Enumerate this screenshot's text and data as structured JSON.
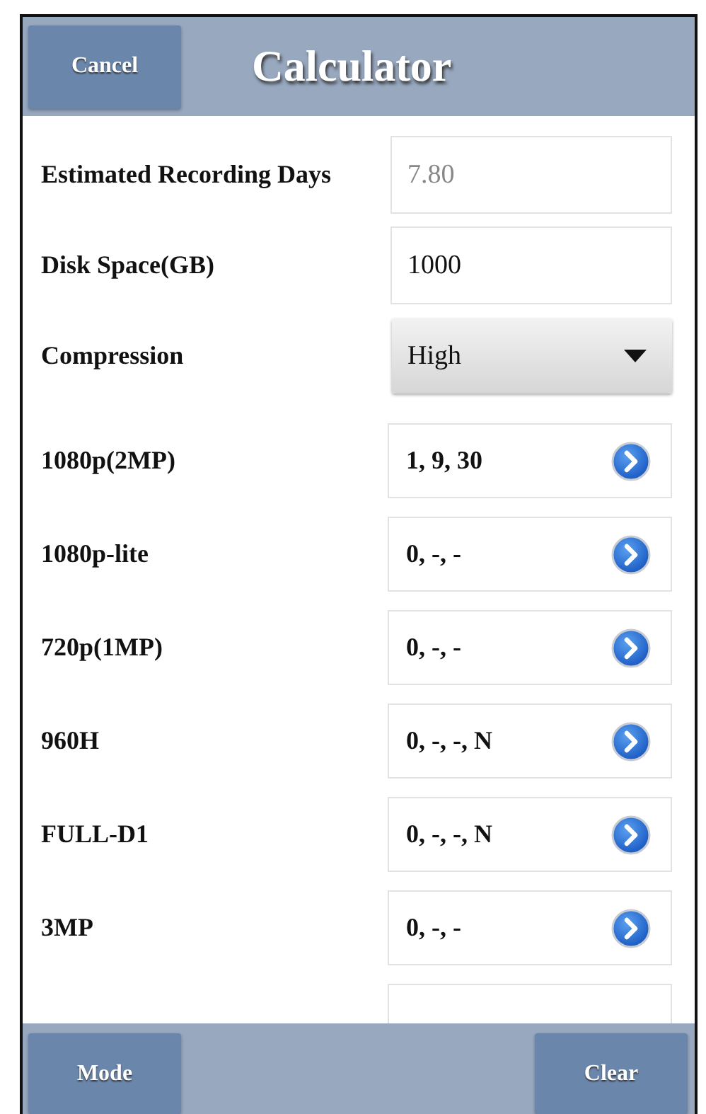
{
  "header": {
    "cancel_button": "Cancel",
    "title": "Calculator"
  },
  "settings": [
    {
      "kind": "readonly",
      "label": "Estimated Recording Days",
      "value": "7.80"
    },
    {
      "kind": "input",
      "label": "Disk Space(GB)",
      "value": "1000"
    },
    {
      "kind": "select",
      "label": "Compression",
      "value": "High"
    }
  ],
  "resolutions": [
    {
      "label": "1080p(2MP)",
      "value": "1, 9, 30"
    },
    {
      "label": "1080p-lite",
      "value": "0, -, -"
    },
    {
      "label": "720p(1MP)",
      "value": "0, -, -"
    },
    {
      "label": "960H",
      "value": "0, -, -, N"
    },
    {
      "label": "FULL-D1",
      "value": "0, -, -, N"
    },
    {
      "label": "3MP",
      "value": "0, -, -"
    }
  ],
  "footer": {
    "mode_button": "Mode",
    "clear_button": "Clear"
  }
}
